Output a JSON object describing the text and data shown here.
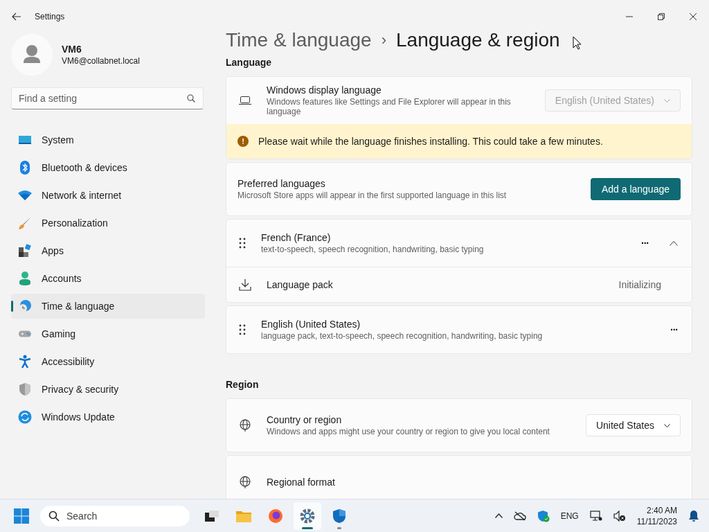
{
  "window": {
    "title": "Settings"
  },
  "user": {
    "name": "VM6",
    "email": "VM6@collabnet.local"
  },
  "search": {
    "placeholder": "Find a setting"
  },
  "sidebar": {
    "items": [
      {
        "label": "System",
        "selected": false
      },
      {
        "label": "Bluetooth & devices",
        "selected": false
      },
      {
        "label": "Network & internet",
        "selected": false
      },
      {
        "label": "Personalization",
        "selected": false
      },
      {
        "label": "Apps",
        "selected": false
      },
      {
        "label": "Accounts",
        "selected": false
      },
      {
        "label": "Time & language",
        "selected": true
      },
      {
        "label": "Gaming",
        "selected": false
      },
      {
        "label": "Accessibility",
        "selected": false
      },
      {
        "label": "Privacy & security",
        "selected": false
      },
      {
        "label": "Windows Update",
        "selected": false
      }
    ]
  },
  "breadcrumb": {
    "parent": "Time & language",
    "separator": "›",
    "current": "Language & region"
  },
  "language_section": {
    "heading": "Language",
    "display_language": {
      "title": "Windows display language",
      "description": "Windows features like Settings and File Explorer will appear in this language",
      "value": "English (United States)",
      "disabled": true
    },
    "warning": {
      "icon": "!",
      "text": "Please wait while the language finishes installing. This could take a few minutes."
    },
    "preferred": {
      "title": "Preferred languages",
      "description": "Microsoft Store apps will appear in the first supported language in this list",
      "button": "Add a language"
    },
    "languages": [
      {
        "name": "French (France)",
        "features": "text-to-speech, speech recognition, handwriting, basic typing",
        "more": "···",
        "expanded": true,
        "pack": {
          "title": "Language pack",
          "status": "Initializing"
        }
      },
      {
        "name": "English (United States)",
        "features": "language pack, text-to-speech, speech recognition, handwriting, basic typing",
        "more": "···"
      }
    ]
  },
  "region_section": {
    "heading": "Region",
    "rows": [
      {
        "title": "Country or region",
        "description": "Windows and apps might use your country or region to give you local content",
        "value": "United States"
      },
      {
        "title": "Regional format"
      }
    ]
  },
  "taskbar": {
    "search": "Search",
    "apps": [
      {
        "selected": false,
        "running": false
      },
      {
        "selected": false,
        "running": false
      },
      {
        "selected": false,
        "running": false
      },
      {
        "selected": true,
        "running": true
      },
      {
        "selected": false,
        "running": true
      }
    ],
    "language": "ENG",
    "time": "2:40 AM",
    "date": "11/11/2023"
  }
}
